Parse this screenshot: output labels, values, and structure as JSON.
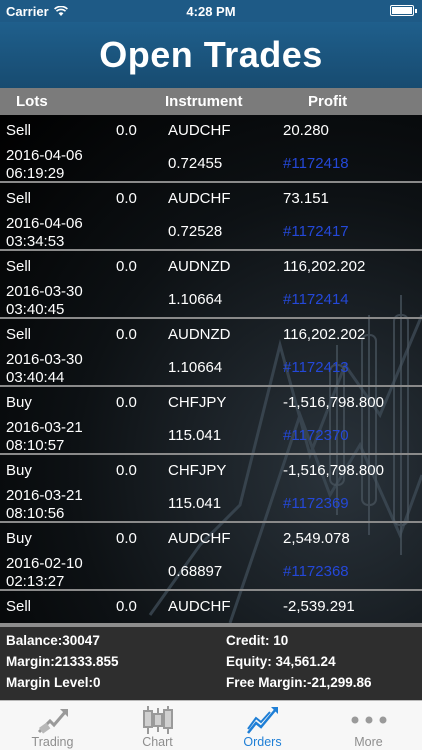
{
  "status_bar": {
    "carrier": "Carrier",
    "time": "4:28 PM"
  },
  "header": {
    "title": "Open Trades"
  },
  "columns": {
    "lots": "Lots",
    "instrument": "Instrument",
    "profit": "Profit"
  },
  "trades": [
    {
      "type": "Sell",
      "lots": "0.0",
      "instrument": "AUDCHF",
      "profit": "20.280",
      "date": "2016-04-06",
      "time": "06:19:29",
      "price": "0.72455",
      "ticket": "#1172418"
    },
    {
      "type": "Sell",
      "lots": "0.0",
      "instrument": "AUDCHF",
      "profit": "73.151",
      "date": "2016-04-06",
      "time": "03:34:53",
      "price": "0.72528",
      "ticket": "#1172417"
    },
    {
      "type": "Sell",
      "lots": "0.0",
      "instrument": "AUDNZD",
      "profit": "116,202.202",
      "date": "2016-03-30",
      "time": "03:40:45",
      "price": "1.10664",
      "ticket": "#1172414"
    },
    {
      "type": "Sell",
      "lots": "0.0",
      "instrument": "AUDNZD",
      "profit": "116,202.202",
      "date": "2016-03-30",
      "time": "03:40:44",
      "price": "1.10664",
      "ticket": "#1172413"
    },
    {
      "type": "Buy",
      "lots": "0.0",
      "instrument": "CHFJPY",
      "profit": "-1,516,798.800",
      "date": "2016-03-21",
      "time": "08:10:57",
      "price": "115.041",
      "ticket": "#1172370"
    },
    {
      "type": "Buy",
      "lots": "0.0",
      "instrument": "CHFJPY",
      "profit": "-1,516,798.800",
      "date": "2016-03-21",
      "time": "08:10:56",
      "price": "115.041",
      "ticket": "#1172369"
    },
    {
      "type": "Buy",
      "lots": "0.0",
      "instrument": "AUDCHF",
      "profit": "2,549.078",
      "date": "2016-02-10",
      "time": "02:13:27",
      "price": "0.68897",
      "ticket": "#1172368"
    },
    {
      "type": "Sell",
      "lots": "0.0",
      "instrument": "AUDCHF",
      "profit": "-2,539.291",
      "date": "",
      "time": "",
      "price": "",
      "ticket": ""
    }
  ],
  "summary": {
    "balance_label": "Balance:",
    "balance": "30047",
    "credit_label": "Credit:",
    "credit": "10",
    "margin_label": "Margin:",
    "margin": "21333.855",
    "equity_label": "Equity:",
    "equity": "34,561.24",
    "margin_level_label": "Margin Level:",
    "margin_level": "0",
    "free_margin_label": "Free Margin:",
    "free_margin": "-21,299.86"
  },
  "tabs": [
    {
      "label": "Trading",
      "icon": "trading-icon",
      "active": false
    },
    {
      "label": "Chart",
      "icon": "candlestick-icon",
      "active": false
    },
    {
      "label": "Orders",
      "icon": "orders-chart-icon",
      "active": true
    },
    {
      "label": "More",
      "icon": "more-dots-icon",
      "active": false
    }
  ],
  "colors": {
    "header": "#1f5f8c",
    "ticket": "#2448d8",
    "active_tab": "#1f7fd6"
  }
}
